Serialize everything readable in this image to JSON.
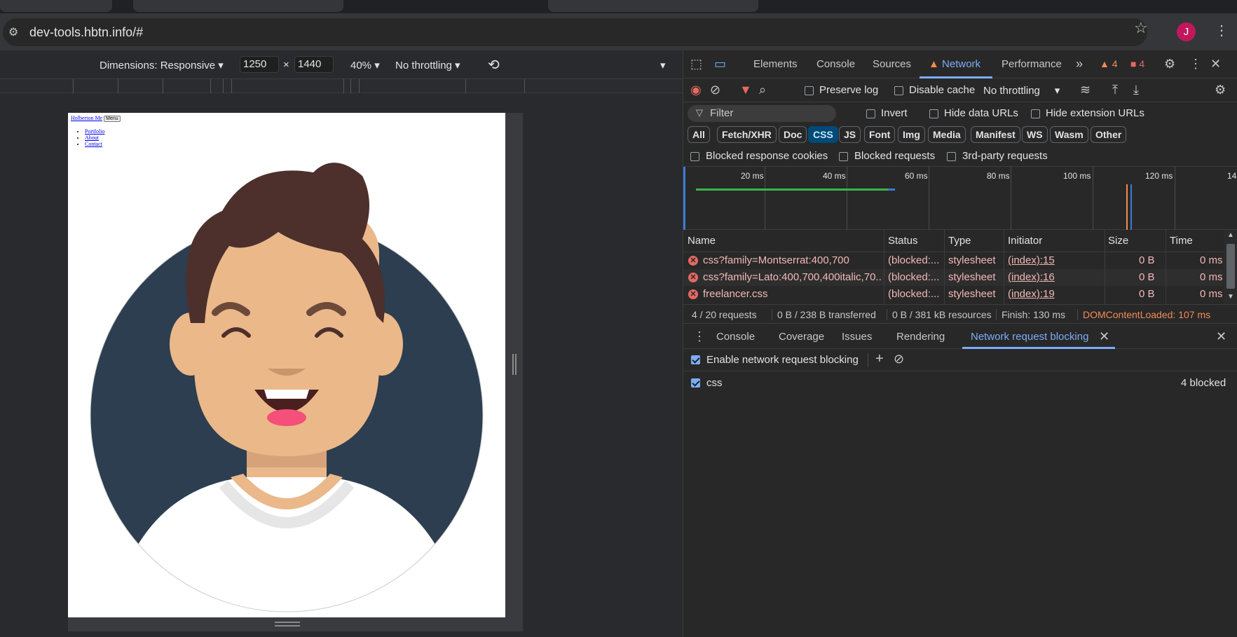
{
  "browser": {
    "url": "dev-tools.hbtn.info/#",
    "profile_initial": "J"
  },
  "device_toolbar": {
    "dimensions_label": "Dimensions: Responsive",
    "width_value": "1250",
    "height_value": "1440",
    "times": "×",
    "zoom": "40%",
    "throttling": "No throttling"
  },
  "page": {
    "brand": "Holberton Me",
    "menu_button": "Menu",
    "links": [
      "Portfolio",
      "About",
      "Contact"
    ]
  },
  "devtools": {
    "tabs": [
      "Elements",
      "Console",
      "Sources",
      "Network",
      "Performance"
    ],
    "active_tab": "Network",
    "warnings_count": "4",
    "errors_count": "4"
  },
  "network_toolbar": {
    "preserve_log": "Preserve log",
    "disable_cache": "Disable cache",
    "throttling": "No throttling"
  },
  "filter": {
    "placeholder": "Filter",
    "invert": "Invert",
    "hide_data_urls": "Hide data URLs",
    "hide_extension_urls": "Hide extension URLs"
  },
  "type_filters": [
    "All",
    "Fetch/XHR",
    "Doc",
    "CSS",
    "JS",
    "Font",
    "Img",
    "Media",
    "Manifest",
    "WS",
    "Wasm",
    "Other"
  ],
  "active_type_filter": "CSS",
  "blocked_filters": {
    "blocked_response_cookies": "Blocked response cookies",
    "blocked_requests": "Blocked requests",
    "third_party": "3rd-party requests"
  },
  "timeline": {
    "ticks": [
      "20 ms",
      "40 ms",
      "60 ms",
      "80 ms",
      "100 ms",
      "120 ms",
      "14"
    ]
  },
  "requests_table": {
    "columns": [
      "Name",
      "Status",
      "Type",
      "Initiator",
      "Size",
      "Time"
    ],
    "rows": [
      {
        "name": "css?family=Montserrat:400,700",
        "status": "(blocked:...",
        "type": "stylesheet",
        "initiator": "(index):15",
        "size": "0 B",
        "time": "0 ms"
      },
      {
        "name": "css?family=Lato:400,700,400italic,70...",
        "status": "(blocked:...",
        "type": "stylesheet",
        "initiator": "(index):16",
        "size": "0 B",
        "time": "0 ms"
      },
      {
        "name": "freelancer.css",
        "status": "(blocked:...",
        "type": "stylesheet",
        "initiator": "(index):19",
        "size": "0 B",
        "time": "0 ms"
      }
    ]
  },
  "status_bar": {
    "requests": "4 / 20 requests",
    "transferred": "0 B / 238 B transferred",
    "resources": "0 B / 381 kB resources",
    "finish": "Finish: 130 ms",
    "dom_content_loaded": "DOMContentLoaded: 107 ms"
  },
  "drawer": {
    "tabs": [
      "Console",
      "Coverage",
      "Issues",
      "Rendering",
      "Network request blocking"
    ],
    "active_tab": "Network request blocking",
    "enable_label": "Enable network request blocking",
    "pattern": "css",
    "pattern_count": "4 blocked"
  },
  "colors": {
    "accent": "#7cacf8",
    "error": "#f2b8b5",
    "warning": "#f28b54",
    "avatar_bg": "#2c3e50",
    "skin": "#ebb88a",
    "hair": "#4d302c"
  }
}
